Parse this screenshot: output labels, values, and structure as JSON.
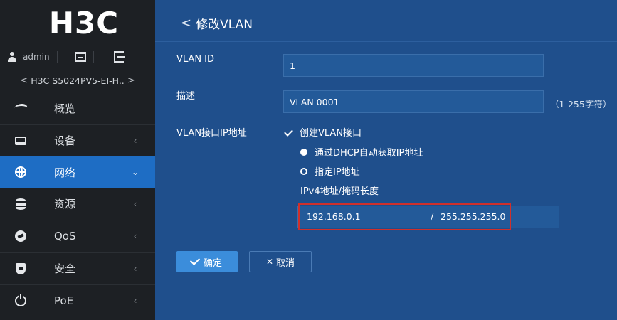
{
  "brand": {
    "logo_text": "H3C"
  },
  "user": {
    "name": "admin"
  },
  "device": {
    "name": "H3C S5024PV5-EI-H..",
    "prev_arrow": "<",
    "next_arrow": ">"
  },
  "sidebar": {
    "items": [
      {
        "label": "概览",
        "icon": "overview-icon",
        "chevron": ""
      },
      {
        "label": "设备",
        "icon": "device-icon",
        "chevron": "‹"
      },
      {
        "label": "网络",
        "icon": "globe-icon",
        "chevron": "⌄",
        "active": true
      },
      {
        "label": "资源",
        "icon": "database-icon",
        "chevron": "‹"
      },
      {
        "label": "QoS",
        "icon": "qos-icon",
        "chevron": "‹"
      },
      {
        "label": "安全",
        "icon": "shield-icon",
        "chevron": "‹"
      },
      {
        "label": "PoE",
        "icon": "power-icon",
        "chevron": "‹"
      }
    ]
  },
  "page": {
    "back_symbol": "<",
    "title": "修改VLAN"
  },
  "form": {
    "vlan_id_label": "VLAN ID",
    "vlan_id_value": "1",
    "desc_label": "描述",
    "desc_value": "VLAN 0001",
    "desc_hint": "（1-255字符）",
    "vlan_ip_label": "VLAN接口IP地址",
    "create_interface_label": "创建VLAN接口",
    "create_interface_checked": true,
    "radio_dhcp_label": "通过DHCP自动获取IP地址",
    "radio_static_label": "指定IP地址",
    "ipv4_label": "IPv4地址/掩码长度",
    "ip_address": "192.168.0.1",
    "slash": "/",
    "mask": "255.255.255.0"
  },
  "buttons": {
    "ok_label": "确定",
    "cancel_label": "取消"
  },
  "colors": {
    "sidebar_bg": "#1d2024",
    "main_bg": "#1f4f8c",
    "active_nav": "#1e6dc4",
    "primary_button": "#3b8ddb",
    "highlight": "#d0302b"
  }
}
